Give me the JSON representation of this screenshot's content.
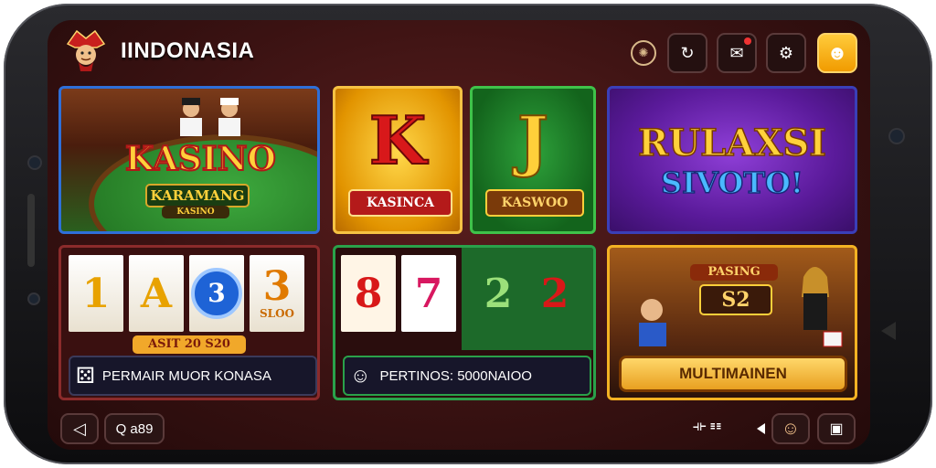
{
  "header": {
    "brand": "IINDONASIA",
    "icons": [
      "coin-icon",
      "refresh-icon",
      "chat-icon",
      "settings-icon",
      "profile-icon"
    ]
  },
  "tiles": {
    "casino": {
      "title": "KASINO",
      "ribbon": "KARAMANG",
      "subribbon": "KASINO"
    },
    "gold": {
      "letter": "K",
      "ribbon": "KASINCA"
    },
    "green": {
      "letter": "J",
      "ribbon": "KASWOO"
    },
    "purple": {
      "title": "RULAXSI",
      "subtitle": "SIVOTO!"
    },
    "slots": {
      "reels": [
        "1",
        "A",
        "3",
        "3"
      ],
      "reel_sub": "SLOO",
      "ribbon": "ASIT 20 S20",
      "banner": "PERMAIR MUOR KONASA"
    },
    "cards": {
      "numbers": [
        "8",
        "7",
        "2",
        "2"
      ],
      "banner": "PERTINOS: 5000NAIOO"
    },
    "multi": {
      "sign_top": "PASING",
      "sign_main": "S2",
      "button": "MULTIMAINEN"
    }
  },
  "bottom": {
    "back_icon": "back-icon",
    "search_label": "Q a89",
    "menu_glyph": "⟛ ☷",
    "avatar_icon": "avatar-icon",
    "window_icon": "window-icon"
  },
  "colors": {
    "gold_accent": "#f6c243",
    "blue_border": "#2e6fd8",
    "green_border": "#3fc24a",
    "purple_bg": "#8f3fd8",
    "dark_bg": "#3a1212"
  }
}
